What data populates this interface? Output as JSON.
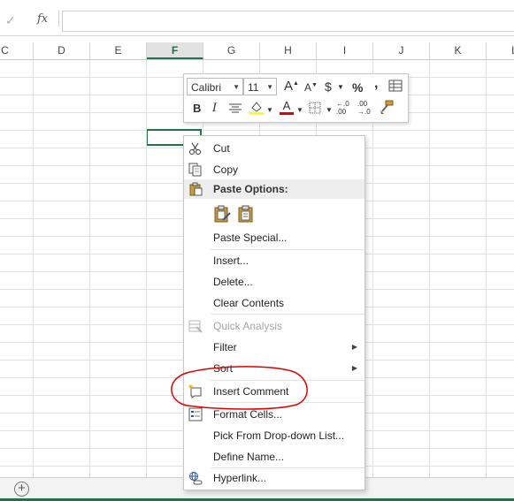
{
  "formula_bar": {
    "check_glyph": "✓",
    "fx_label": "fx"
  },
  "columns": [
    {
      "label": "C",
      "selected": false
    },
    {
      "label": "D",
      "selected": false
    },
    {
      "label": "E",
      "selected": false
    },
    {
      "label": "F",
      "selected": true
    },
    {
      "label": "G",
      "selected": false
    },
    {
      "label": "H",
      "selected": false
    },
    {
      "label": "I",
      "selected": false
    },
    {
      "label": "J",
      "selected": false
    },
    {
      "label": "K",
      "selected": false
    },
    {
      "label": "L",
      "selected": false
    }
  ],
  "mini_toolbar": {
    "font_name": "Calibri",
    "font_size": "11",
    "grow_font": "A",
    "shrink_font": "A",
    "currency": "$",
    "percent": "%",
    "comma": ",",
    "bold": "B",
    "italic": "I",
    "font_color_letter": "A",
    "increase_decimal": "←.0 .00",
    "decrease_decimal": ".00 →.0",
    "colors": {
      "highlight": "#ffff00",
      "font_color": "#e00000"
    }
  },
  "context_menu": {
    "cut": "Cut",
    "copy": "Copy",
    "paste_options": "Paste Options:",
    "paste_special": "Paste Special...",
    "insert": "Insert...",
    "delete": "Delete...",
    "clear_contents": "Clear Contents",
    "quick_analysis": "Quick Analysis",
    "filter": "Filter",
    "sort": "Sort",
    "insert_comment": "Insert Comment",
    "format_cells": "Format Cells...",
    "pick_from_list": "Pick From Drop-down List...",
    "define_name": "Define Name...",
    "hyperlink": "Hyperlink..."
  },
  "sheet_bar": {
    "add_sheet_glyph": "+"
  },
  "colors": {
    "accent": "#217346",
    "annotation": "#e00000"
  }
}
